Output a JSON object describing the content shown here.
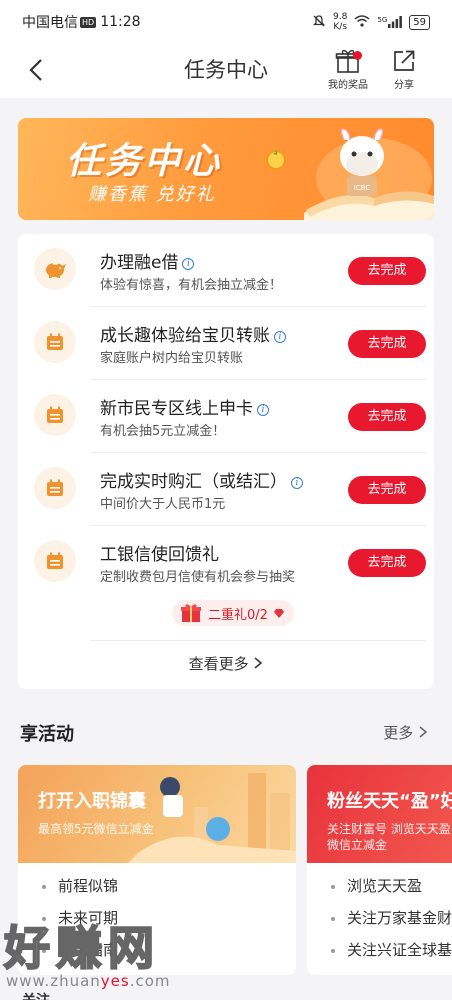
{
  "status_bar": {
    "carrier": "中国电信",
    "hd": "HD",
    "time": "11:28",
    "speed_value": "9.8",
    "speed_unit": "K/s",
    "network": "5G",
    "battery": "59"
  },
  "header": {
    "title": "任务中心",
    "prizes_label": "我的奖品",
    "share_label": "分享"
  },
  "banner": {
    "title": "任务中心",
    "subtitle": "赚香蕉 兑好礼",
    "brand_text": "ICBC"
  },
  "tasks": [
    {
      "title": "办理融e借",
      "desc": "体验有惊喜，有机会抽立减金！",
      "button": "去完成",
      "icon": "piggy-bank-icon"
    },
    {
      "title": "成长趣体验给宝贝转账",
      "desc": "家庭账户树内给宝贝转账",
      "button": "去完成",
      "icon": "calendar-icon"
    },
    {
      "title": "新市民专区线上申卡",
      "desc": "有机会抽5元立减金！",
      "button": "去完成",
      "icon": "calendar-icon"
    },
    {
      "title": "完成实时购汇（或结汇）",
      "desc": "中间价大于人民币1元",
      "button": "去完成",
      "icon": "calendar-icon"
    },
    {
      "title": "工银信使回馈礼",
      "desc": "定制收费包月信使有机会参与抽奖",
      "button": "去完成",
      "icon": "calendar-icon"
    }
  ],
  "gift_pill": {
    "label": "二重礼0/2"
  },
  "view_more": "查看更多",
  "activities": {
    "title": "享活动",
    "more": "更多",
    "cards": [
      {
        "title": "打开入职锦囊",
        "subtitle": "最高领5元微信立减金",
        "items": [
          "前程似锦",
          "未来可期",
          "使用指南"
        ]
      },
      {
        "title": "粉丝天天“盈”好",
        "subtitle": "关注财富号 浏览天天盈 领微信立减金",
        "items": [
          "浏览天天盈",
          "关注万家基金财富号",
          "关注兴证全球基金"
        ]
      }
    ]
  },
  "bottom_peek": "关注",
  "watermark": {
    "big": "好赚网",
    "url_pre": "www.zhuan",
    "url_em": "yes",
    "url_post": ".com"
  },
  "colors": {
    "accent_red": "#e8192f",
    "banner_orange": "#ff9a3c",
    "icon_orange": "#f0922e"
  }
}
